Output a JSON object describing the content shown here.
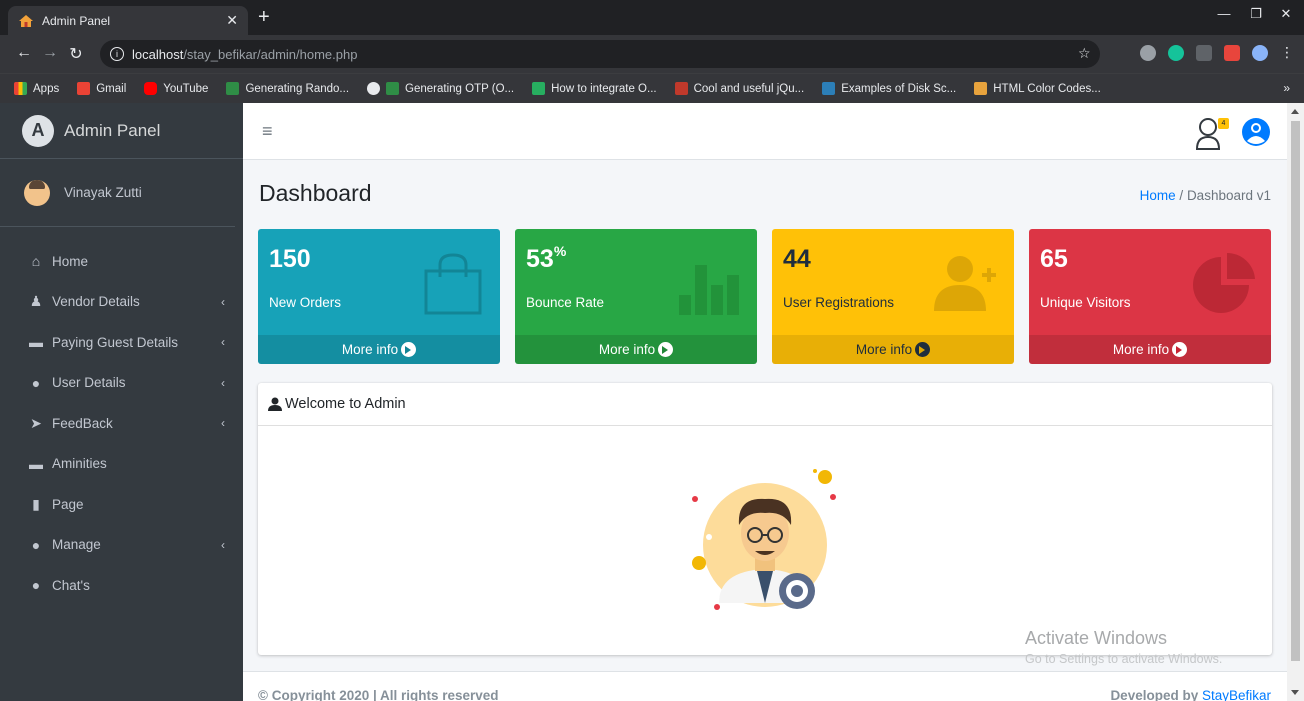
{
  "browser": {
    "tab_title": "Admin Panel",
    "url_host": "localhost",
    "url_path": "/stay_befikar/admin/home.php",
    "bookmarks": [
      "Apps",
      "Gmail",
      "YouTube",
      "Generating Rando...",
      "Generating OTP (O...",
      "How to integrate O...",
      "Cool and useful jQu...",
      "Examples of Disk Sc...",
      "HTML Color Codes..."
    ],
    "more": "»"
  },
  "sidebar": {
    "brand": "Admin Panel",
    "user_name": "Vinayak Zutti",
    "items": [
      {
        "label": "Home",
        "icon": "home-icon",
        "chevron": ""
      },
      {
        "label": "Vendor Details",
        "icon": "male-icon",
        "chevron": "‹"
      },
      {
        "label": "Paying Guest Details",
        "icon": "bed-icon",
        "chevron": "‹"
      },
      {
        "label": "User Details",
        "icon": "users-icon",
        "chevron": "‹"
      },
      {
        "label": "FeedBack",
        "icon": "paper-plane-icon",
        "chevron": "‹"
      },
      {
        "label": "Aminities",
        "icon": "bed-icon",
        "chevron": ""
      },
      {
        "label": "Page",
        "icon": "file-icon",
        "chevron": ""
      },
      {
        "label": "Manage",
        "icon": "user-icon",
        "chevron": "‹"
      },
      {
        "label": "Chat's",
        "icon": "comments-icon",
        "chevron": ""
      }
    ]
  },
  "navbar": {
    "hamburger": "≡",
    "notif_count": "4"
  },
  "header": {
    "title": "Dashboard",
    "crumb_home": "Home",
    "crumb_sep": " / ",
    "crumb_current": "Dashboard v1"
  },
  "stats": [
    {
      "value": "150",
      "sup": "",
      "label": "New Orders",
      "footer": "More info"
    },
    {
      "value": "53",
      "sup": "%",
      "label": "Bounce Rate",
      "footer": "More info"
    },
    {
      "value": "44",
      "sup": "",
      "label": "User Registrations",
      "footer": "More info"
    },
    {
      "value": "65",
      "sup": "",
      "label": "Unique Visitors",
      "footer": "More info"
    }
  ],
  "card": {
    "title": "Welcome to Admin"
  },
  "watermark": {
    "line1": "Activate Windows",
    "line2": "Go to Settings to activate Windows."
  },
  "footer": {
    "copyright": "© Copyright 2020 | All rights reserved",
    "dev_prefix": "Developed by ",
    "dev_link": "StayBefikar"
  },
  "colors": {
    "info": "#17a2b8",
    "success": "#28a745",
    "warning": "#ffc107",
    "danger": "#dc3545",
    "sidebar": "#343a40",
    "link": "#007bff"
  }
}
